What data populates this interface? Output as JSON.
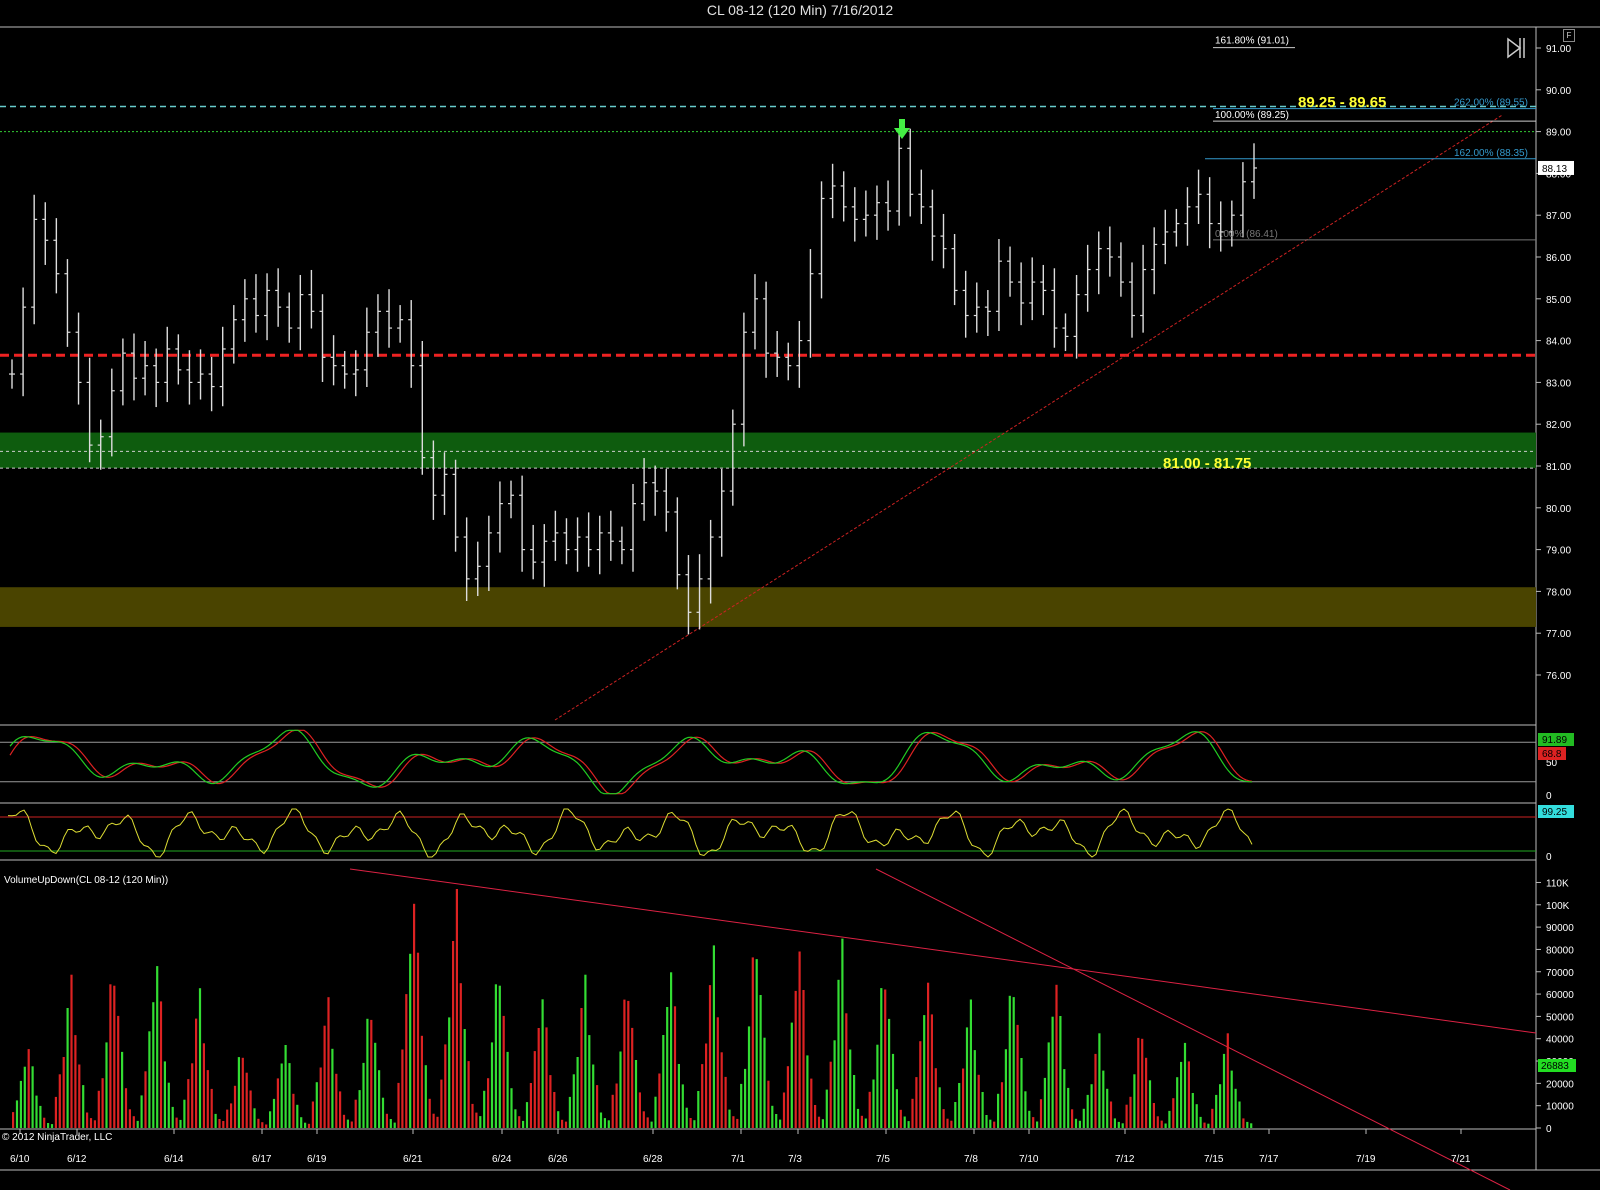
{
  "window": {
    "title": "CL 08-12 (120 Min)  7/16/2012",
    "corner_button": "F",
    "copyright": "© 2012 NinjaTrader, LLC"
  },
  "colors": {
    "background": "#000000",
    "up_volume": "#33dd33",
    "down_volume": "#dd2222",
    "support_zone": "#0e5c0e",
    "lower_zone": "#4a4400",
    "stoch_k": "#22cc22",
    "stoch_d": "#dd2222",
    "wr_line": "#dddd33",
    "wr_extreme": "#33dddd",
    "annotation_yellow": "#ffff33",
    "fib_blue": "#3399cc"
  },
  "chart_data": [
    {
      "type": "ohlc",
      "symbol": "CL 08-12 (120 Min)",
      "price_ylim": [
        75.3,
        91.6
      ],
      "y_ticks": [
        "76.00",
        "77.00",
        "78.00",
        "79.00",
        "80.00",
        "81.00",
        "82.00",
        "83.00",
        "84.00",
        "85.00",
        "86.00",
        "87.00",
        "88.00",
        "89.00",
        "90.00",
        "91.00"
      ],
      "last_price": "88.13",
      "x_tick_labels": [
        "6/10",
        "6/12",
        "6/14",
        "6/17",
        "6/19",
        "6/21",
        "6/24",
        "6/26",
        "6/28",
        "7/1",
        "7/3",
        "7/5",
        "7/8",
        "7/10",
        "7/12",
        "7/15",
        "7/17",
        "7/19",
        "7/21"
      ],
      "close_series": [
        83.2,
        84.8,
        86.9,
        86.4,
        85.6,
        84.2,
        83.0,
        81.5,
        81.7,
        82.8,
        83.7,
        83.1,
        83.4,
        83.0,
        83.8,
        83.3,
        83.0,
        83.2,
        82.9,
        83.8,
        84.5,
        85.0,
        84.6,
        85.2,
        84.8,
        84.3,
        85.1,
        84.7,
        83.6,
        83.4,
        83.2,
        83.3,
        84.2,
        84.7,
        84.3,
        84.5,
        83.4,
        81.2,
        80.3,
        80.8,
        79.3,
        78.3,
        78.6,
        79.4,
        80.1,
        80.3,
        79.0,
        78.7,
        79.2,
        79.4,
        79.0,
        79.3,
        79.0,
        79.4,
        79.2,
        79.0,
        80.1,
        80.6,
        80.4,
        79.9,
        78.4,
        77.5,
        78.3,
        79.3,
        80.4,
        82.0,
        84.2,
        85.0,
        83.7,
        83.6,
        83.4,
        84.0,
        85.6,
        87.4,
        87.7,
        87.2,
        86.9,
        87.0,
        87.3,
        87.1,
        88.6,
        87.5,
        87.2,
        86.5,
        86.2,
        85.2,
        84.6,
        84.8,
        84.7,
        85.9,
        85.4,
        84.9,
        85.4,
        85.2,
        84.3,
        84.1,
        85.1,
        85.7,
        86.2,
        86.0,
        85.4,
        84.6,
        85.7,
        86.3,
        86.6,
        86.8,
        87.2,
        87.5,
        86.8,
        86.6,
        87.0,
        87.8,
        88.13
      ],
      "annotations": {
        "zone_upper_label": "89.25 - 89.65",
        "zone_support_label": "81.00 - 81.75",
        "zone_support_range": [
          81.0,
          81.75
        ],
        "zone_lower_range": [
          77.15,
          78.1
        ],
        "dashed_red_level": 83.65,
        "dashed_cyan_level": 89.6,
        "dotted_green_level": 89.0,
        "fib_labels": [
          "161.80% (91.01)",
          "262.00% (89.55)",
          "100.00% (89.25)",
          "162.00% (88.35)",
          "0.00% (86.41)"
        ],
        "fib_levels": [
          91.01,
          89.55,
          89.25,
          88.35,
          86.41
        ]
      }
    },
    {
      "type": "line",
      "name": "stochastics",
      "y_ticks": [
        "50",
        "0"
      ],
      "values_labels": [
        "91.89",
        "68.8"
      ]
    },
    {
      "type": "line",
      "name": "williams",
      "y_ticks": [
        "0"
      ],
      "values_labels": [
        "99.25"
      ]
    },
    {
      "type": "bar",
      "title": "VolumeUpDown(CL 08-12 (120 Min))",
      "y_ticks": [
        "0",
        "10000",
        "20000",
        "30000",
        "40000",
        "50000",
        "60000",
        "70000",
        "80000",
        "90000",
        "100K",
        "110K"
      ],
      "ylim": [
        0,
        112000
      ],
      "last_volume": "26883",
      "peaks": [
        {
          "x": "6/10",
          "value": 38000,
          "dir": "up"
        },
        {
          "x": "6/11",
          "value": 68000,
          "dir": "down"
        },
        {
          "x": "6/12",
          "value": 75000,
          "dir": "down"
        },
        {
          "x": "6/13",
          "value": 78000,
          "dir": "up"
        },
        {
          "x": "6/14",
          "value": 62000,
          "dir": "down"
        },
        {
          "x": "6/15",
          "value": 37000,
          "dir": "down"
        },
        {
          "x": "6/17",
          "value": 40000,
          "dir": "up"
        },
        {
          "x": "6/18",
          "value": 58000,
          "dir": "down"
        },
        {
          "x": "6/19",
          "value": 57000,
          "dir": "up"
        },
        {
          "x": "6/20",
          "value": 108000,
          "dir": "down"
        },
        {
          "x": "6/21",
          "value": 106000,
          "dir": "down"
        },
        {
          "x": "6/22",
          "value": 75000,
          "dir": "up"
        },
        {
          "x": "6/24",
          "value": 62000,
          "dir": "down"
        },
        {
          "x": "6/25",
          "value": 68000,
          "dir": "up"
        },
        {
          "x": "6/26",
          "value": 67000,
          "dir": "down"
        },
        {
          "x": "6/27",
          "value": 75000,
          "dir": "up"
        },
        {
          "x": "6/28",
          "value": 81000,
          "dir": "down"
        },
        {
          "x": "6/29",
          "value": 89000,
          "dir": "up"
        },
        {
          "x": "7/1",
          "value": 85000,
          "dir": "down"
        },
        {
          "x": "7/2",
          "value": 84000,
          "dir": "up"
        },
        {
          "x": "7/3",
          "value": 73000,
          "dir": "up"
        },
        {
          "x": "7/5",
          "value": 70000,
          "dir": "down"
        },
        {
          "x": "7/6",
          "value": 57000,
          "dir": "up"
        },
        {
          "x": "7/8",
          "value": 69000,
          "dir": "up"
        },
        {
          "x": "7/9",
          "value": 69000,
          "dir": "up"
        },
        {
          "x": "7/10",
          "value": 42000,
          "dir": "up"
        },
        {
          "x": "7/11",
          "value": 47000,
          "dir": "down"
        },
        {
          "x": "7/12",
          "value": 41000,
          "dir": "up"
        },
        {
          "x": "7/15",
          "value": 42000,
          "dir": "up"
        }
      ]
    }
  ]
}
